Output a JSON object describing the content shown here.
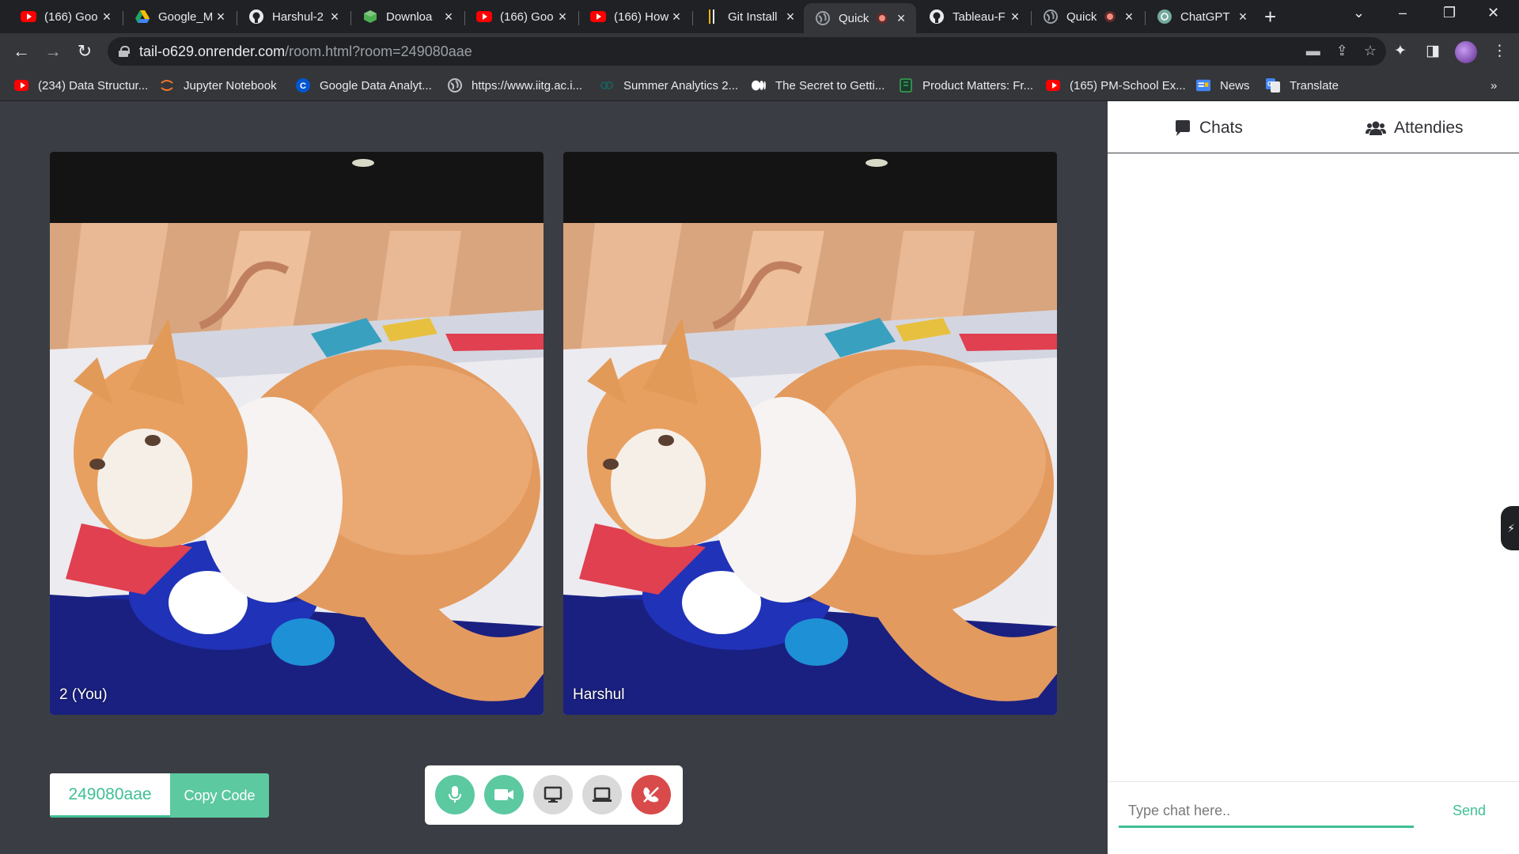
{
  "browser": {
    "tabs": [
      {
        "title": "(166) Goo",
        "icon": "youtube-icon"
      },
      {
        "title": "Google_M",
        "icon": "google-drive-icon"
      },
      {
        "title": "Harshul-2",
        "icon": "github-icon"
      },
      {
        "title": "Downloa",
        "icon": "cube-icon"
      },
      {
        "title": "(166) Goo",
        "icon": "youtube-icon"
      },
      {
        "title": "(166) How",
        "icon": "youtube-icon"
      },
      {
        "title": "Git Install",
        "icon": "git-icon"
      },
      {
        "title": "Quick",
        "icon": "globe-icon",
        "active": true,
        "recording": true
      },
      {
        "title": "Tableau-F",
        "icon": "github-icon"
      },
      {
        "title": "Quick",
        "icon": "globe-icon",
        "recording": true
      },
      {
        "title": "ChatGPT",
        "icon": "openai-icon"
      }
    ],
    "url_host": "tail-o629.onrender.com",
    "url_path": "/room.html?room=249080aae",
    "bookmarks": [
      {
        "label": "(234) Data Structur...",
        "icon": "youtube-icon"
      },
      {
        "label": "Jupyter Notebook",
        "icon": "jupyter-icon"
      },
      {
        "label": "Google Data Analyt...",
        "icon": "coursera-icon"
      },
      {
        "label": "https://www.iitg.ac.i...",
        "icon": "globe-icon"
      },
      {
        "label": "Summer Analytics 2...",
        "icon": "link-icon"
      },
      {
        "label": "The Secret to Getti...",
        "icon": "medium-icon"
      },
      {
        "label": "Product Matters: Fr...",
        "icon": "book-icon"
      },
      {
        "label": "(165) PM-School Ex...",
        "icon": "youtube-icon"
      },
      {
        "label": "News",
        "icon": "google-news-icon"
      },
      {
        "label": "Translate",
        "icon": "google-translate-icon"
      }
    ],
    "bookmarks_overflow": "»"
  },
  "room": {
    "videos": [
      {
        "label": "2 (You)"
      },
      {
        "label": "Harshul"
      }
    ],
    "room_code": "249080aae",
    "copy_label": "Copy Code",
    "controls": [
      {
        "name": "mic-icon",
        "color": "#5cc9a0"
      },
      {
        "name": "camera-icon",
        "color": "#5cc9a0"
      },
      {
        "name": "screen-share-icon",
        "color": "#d9d9d9"
      },
      {
        "name": "laptop-icon",
        "color": "#d9d9d9"
      },
      {
        "name": "leave-call-icon",
        "color": "#d94a4a"
      }
    ]
  },
  "sidebar": {
    "tab_chats": "Chats",
    "tab_attendees": "Attendies",
    "chat_placeholder": "Type chat here..",
    "send_label": "Send"
  },
  "colors": {
    "accent": "#3fbf95",
    "danger": "#d94a4a",
    "stage_bg": "#3a3d43"
  }
}
